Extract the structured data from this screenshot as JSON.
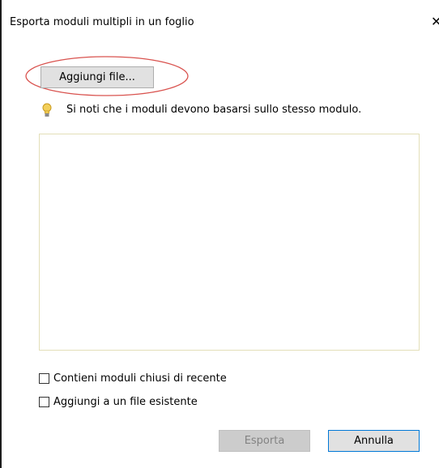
{
  "dialog": {
    "title": "Esporta moduli multipli in un foglio",
    "close_glyph": "✕"
  },
  "add_files": {
    "label": "Aggiungi file...",
    "highlight_color": "#d9534f"
  },
  "note": {
    "icon": "lightbulb-icon",
    "text": "Si noti che i moduli devono basarsi sullo stesso modulo."
  },
  "file_list": {
    "items": []
  },
  "options": [
    {
      "label": "Contieni moduli chiusi di recente",
      "checked": false
    },
    {
      "label": "Aggiungi a un file esistente",
      "checked": false
    }
  ],
  "buttons": {
    "export_label": "Esporta",
    "export_enabled": false,
    "cancel_label": "Annulla",
    "accent_color": "#0078d7"
  }
}
